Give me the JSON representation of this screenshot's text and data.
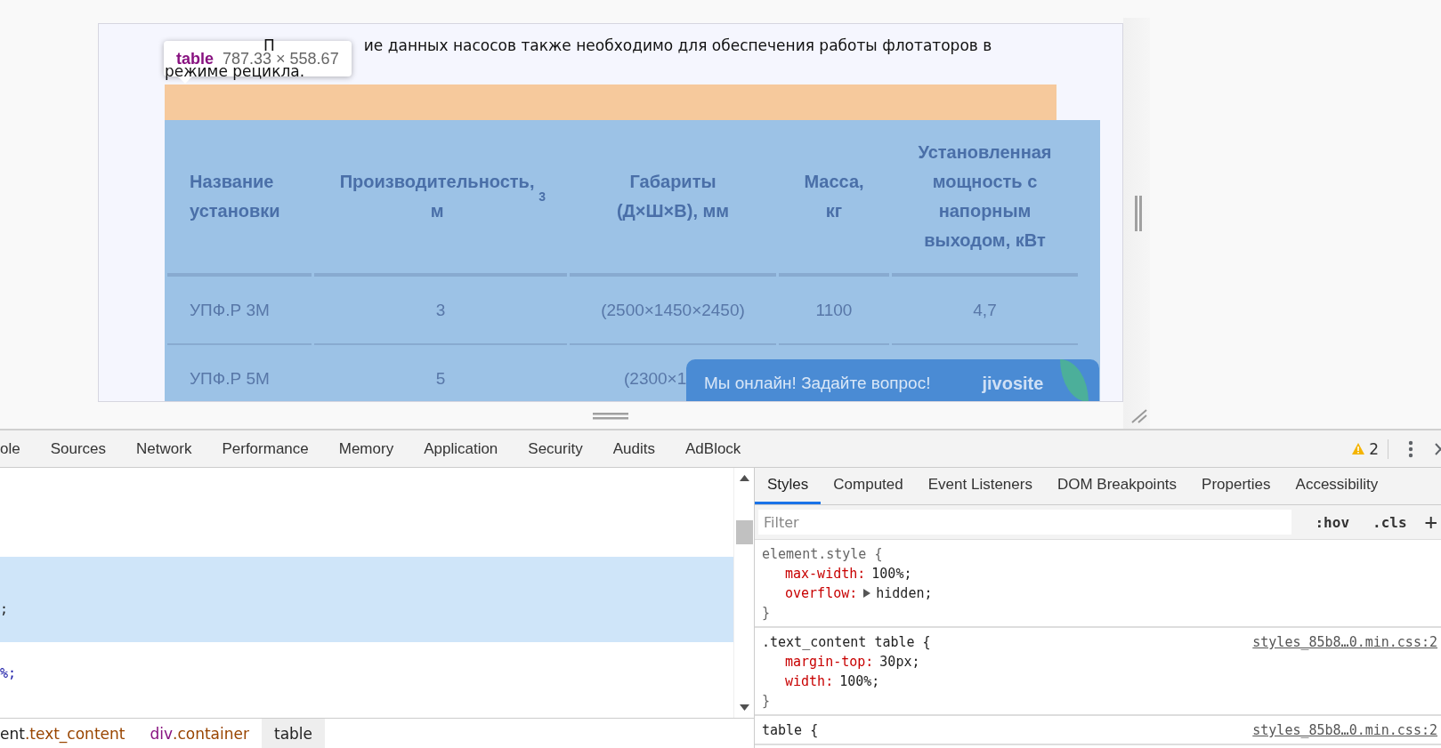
{
  "page": {
    "fragments": [
      "П",
      "ие данных насосов также необходимо для обеспечения работы флотаторов в",
      "режиме рецикла."
    ]
  },
  "inspect_tooltip": {
    "tag": "table",
    "size": "787.33 × 558.67"
  },
  "table": {
    "columns": [
      "Название установки",
      "Производительность, м$^{3}$",
      "Габариты (Д×Ш×В), мм",
      "Масса, кг",
      "Установленная мощность с напорным выходом, кВт"
    ],
    "rows": [
      [
        "УПФ.Р 3М",
        "3",
        "(2500×1450×2450)",
        "1100",
        "4,7"
      ],
      [
        "УПФ.Р 5М",
        "5",
        "(2300×1"
      ]
    ]
  },
  "chat_widget": {
    "text": "Мы онлайн! Задайте вопрос!",
    "logo": "jivosite"
  },
  "devtools": {
    "tabs": [
      {
        "label": "ole",
        "selected": false
      },
      {
        "label": "Sources",
        "selected": false
      },
      {
        "label": "Network",
        "selected": false
      },
      {
        "label": "Performance",
        "selected": false
      },
      {
        "label": "Memory",
        "selected": false
      },
      {
        "label": "Application",
        "selected": false
      },
      {
        "label": "Security",
        "selected": false
      },
      {
        "label": "Audits",
        "selected": false
      },
      {
        "label": "AdBlock",
        "selected": false
      }
    ],
    "warning_count": "2",
    "element_lines": [
      {
        "text": ";",
        "selected": true
      },
      {
        "text": "%;",
        "selected": false
      }
    ],
    "breadcrumbs": [
      {
        "tag": "ent",
        "cls": ".text_content",
        "selected": false
      },
      {
        "tag": "div",
        "cls": ".container",
        "selected": false
      },
      {
        "tag": "table",
        "selected": true
      }
    ],
    "side_tabs": [
      {
        "label": "Styles",
        "selected": true
      },
      {
        "label": "Computed",
        "selected": false
      },
      {
        "label": "Event Listeners",
        "selected": false
      },
      {
        "label": "DOM Breakpoints",
        "selected": false
      },
      {
        "label": "Properties",
        "selected": false
      },
      {
        "label": "Accessibility",
        "selected": false
      }
    ],
    "filter": {
      "placeholder": "Filter"
    },
    "hov": ":hov",
    "cls": ".cls",
    "add": "+",
    "rules": [
      {
        "kind": "inline",
        "selector": "element.style {",
        "props": [
          {
            "name": "max-width:",
            "value": "100%;",
            "expandable": false
          },
          {
            "name": "overflow:",
            "value": "hidden;",
            "expandable": true
          }
        ],
        "close": "}"
      },
      {
        "kind": "rule",
        "selector": ".text_content table {",
        "source": "styles_85b8…0.min.css:2",
        "props": [
          {
            "name": "margin-top:",
            "value": "30px;",
            "expandable": false
          },
          {
            "name": "width:",
            "value": "100%;",
            "expandable": false
          }
        ],
        "close": "}"
      },
      {
        "kind": "rule",
        "selector": "table {",
        "source": "styles_85b8…0.min.css:2"
      }
    ]
  }
}
